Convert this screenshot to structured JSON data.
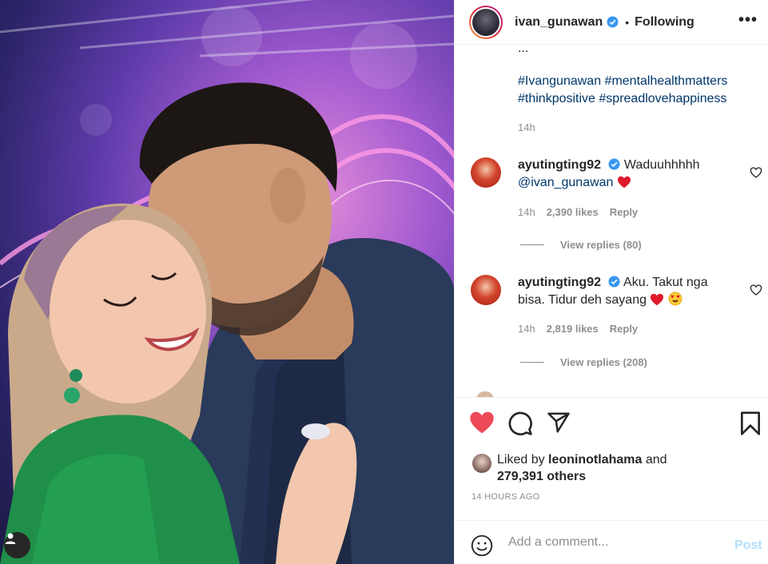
{
  "post": {
    "author": "ivan_gunawan",
    "follow_status": "Following",
    "separator": "•",
    "more": "•••",
    "caption_tail": "...",
    "hashtags": [
      "#Ivangunawan",
      "#mentalhealthmatters",
      "#thinkpositive",
      "#spreadlovehappiness"
    ],
    "caption_time": "14h"
  },
  "comments": [
    {
      "username": "ayutingting92",
      "text": "Waduuhhhhh",
      "mention": "@ivan_gunawan",
      "time": "14h",
      "likes": "2,390 likes",
      "reply": "Reply",
      "view_replies": "View replies (80)"
    },
    {
      "username": "ayutingting92",
      "text": "Aku. Takut nga bisa. Tidur deh sayang",
      "time": "14h",
      "likes": "2,819 likes",
      "reply": "Reply",
      "view_replies": "View replies (208)"
    }
  ],
  "likes": {
    "prefix": "Liked by",
    "user": "leoninotlahama",
    "and": "and",
    "others": "279,391 others"
  },
  "timestamp": "14 HOURS AGO",
  "add_comment": {
    "placeholder": "Add a comment...",
    "post_label": "Post"
  },
  "colors": {
    "heart_liked": "#ed4956",
    "link": "#00376b",
    "muted": "#8e8e8e",
    "verified": "#3897f0",
    "post_disabled": "#b2dffc"
  },
  "icons": [
    "verified-icon",
    "more-icon",
    "heart-icon",
    "comment-icon",
    "share-icon",
    "bookmark-icon",
    "smile-icon",
    "user-tag-icon"
  ]
}
